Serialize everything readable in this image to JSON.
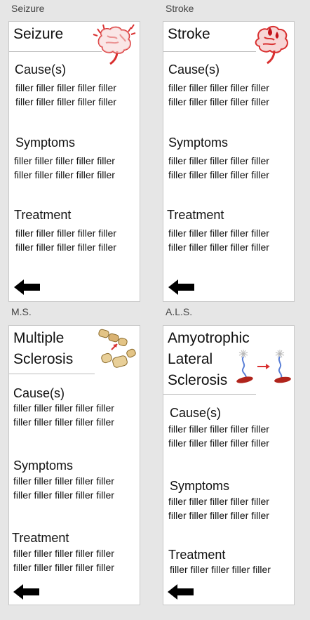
{
  "slides": [
    {
      "label": "Seizure",
      "title": "Seizure",
      "cause_heading": "Cause(s)",
      "cause_text": [
        "filler filler filler filler filler",
        "filler filler filler filler filler"
      ],
      "symptoms_heading": "Symptoms",
      "symptoms_text": [
        "filler filler filler filler filler",
        "filler filler filler filler filler"
      ],
      "treatment_heading": "Treatment",
      "treatment_text": [
        "filler filler filler filler filler",
        "filler filler filler filler filler"
      ],
      "icon": "brain-seizure-icon"
    },
    {
      "label": "Stroke",
      "title": "Stroke",
      "cause_heading": "Cause(s)",
      "cause_text": [
        "filler filler filler filler filler",
        "filler filler filler filler filler"
      ],
      "symptoms_heading": "Symptoms",
      "symptoms_text": [
        "filler filler filler filler filler",
        "filler filler filler filler filler"
      ],
      "treatment_heading": "Treatment",
      "treatment_text": [
        "filler filler filler filler filler",
        "filler filler filler filler filler"
      ],
      "icon": "brain-stroke-icon"
    },
    {
      "label": "M.S.",
      "title_lines": [
        "Multiple",
        "Sclerosis"
      ],
      "cause_heading": "Cause(s)",
      "cause_text": [
        "filler filler filler filler filler",
        "filler filler filler filler filler"
      ],
      "symptoms_heading": "Symptoms",
      "symptoms_text": [
        "filler filler filler filler filler",
        "filler filler filler filler filler"
      ],
      "treatment_heading": "Treatment",
      "treatment_text": [
        "filler filler filler filler filler",
        "filler filler filler filler filler"
      ],
      "icon": "nerve-fiber-icon"
    },
    {
      "label": "A.L.S.",
      "title_lines": [
        "Amyotrophic",
        "Lateral",
        "Sclerosis"
      ],
      "cause_heading": "Cause(s)",
      "cause_text": [
        "filler filler filler filler filler",
        "filler filler filler filler filler"
      ],
      "symptoms_heading": "Symptoms",
      "symptoms_text": [
        "filler filler filler filler filler",
        "filler filler filler filler filler"
      ],
      "treatment_heading": "Treatment",
      "treatment_text": [
        "filler filler filler filler filler"
      ],
      "icon": "motor-neuron-icon"
    }
  ],
  "colors": {
    "background": "#e6e6e6",
    "card": "#ffffff",
    "icon_red": "#d93030",
    "arrow": "#000000"
  },
  "back_icon": "back-arrow-icon"
}
